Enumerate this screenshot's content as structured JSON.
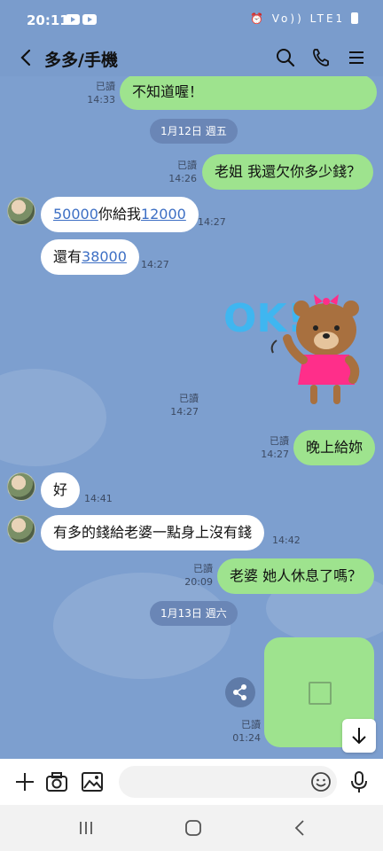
{
  "status_bar": {
    "time": "20:11",
    "network": "Vo)) LTE1"
  },
  "header": {
    "title": "多多/手機",
    "icons": [
      "back-arrow-icon",
      "search-icon",
      "phone-icon",
      "menu-icon"
    ]
  },
  "messages": [
    {
      "id": "m1",
      "side": "out",
      "text": "不知道喔！",
      "read": "已讀",
      "time": "14:33"
    },
    {
      "id": "d1",
      "type": "date",
      "text": "1月12日 週五"
    },
    {
      "id": "m2",
      "side": "out",
      "text": "老姐 我還欠你多少錢？",
      "read": "已讀",
      "time": "14:26"
    },
    {
      "id": "m3",
      "side": "in",
      "parts": [
        "50000",
        "你給我",
        "12000"
      ],
      "time": "14:27"
    },
    {
      "id": "m4",
      "side": "in",
      "parts": [
        "還有",
        "38000"
      ],
      "time": "14:27"
    },
    {
      "id": "m5",
      "side": "out",
      "type": "sticker",
      "sticker_text": "OK!",
      "read": "已讀",
      "time": "14:27"
    },
    {
      "id": "m6",
      "side": "out",
      "text": "晚上給妳",
      "read": "已讀",
      "time": "14:27"
    },
    {
      "id": "m7",
      "side": "in",
      "text": "好",
      "time": "14:41"
    },
    {
      "id": "m8",
      "side": "in",
      "text": "有多的錢給老婆一點身上沒有錢",
      "time": "14:42"
    },
    {
      "id": "m9",
      "side": "out",
      "text": "老婆 她人休息了嗎？",
      "read": "已讀",
      "time": "20:09"
    },
    {
      "id": "d2",
      "type": "date",
      "text": "1月13日 週六"
    },
    {
      "id": "m10",
      "side": "out",
      "type": "image",
      "read": "已讀",
      "time": "01:24"
    }
  ],
  "input_bar": {
    "placeholder": "",
    "icons": [
      "plus-icon",
      "camera-icon",
      "gallery-icon",
      "emoji-icon",
      "mic-icon"
    ]
  },
  "colors": {
    "chat_bg": "#7d9fcf",
    "out_bubble": "#9ee38e",
    "in_bubble": "#ffffff",
    "link": "#3d6fc4"
  }
}
